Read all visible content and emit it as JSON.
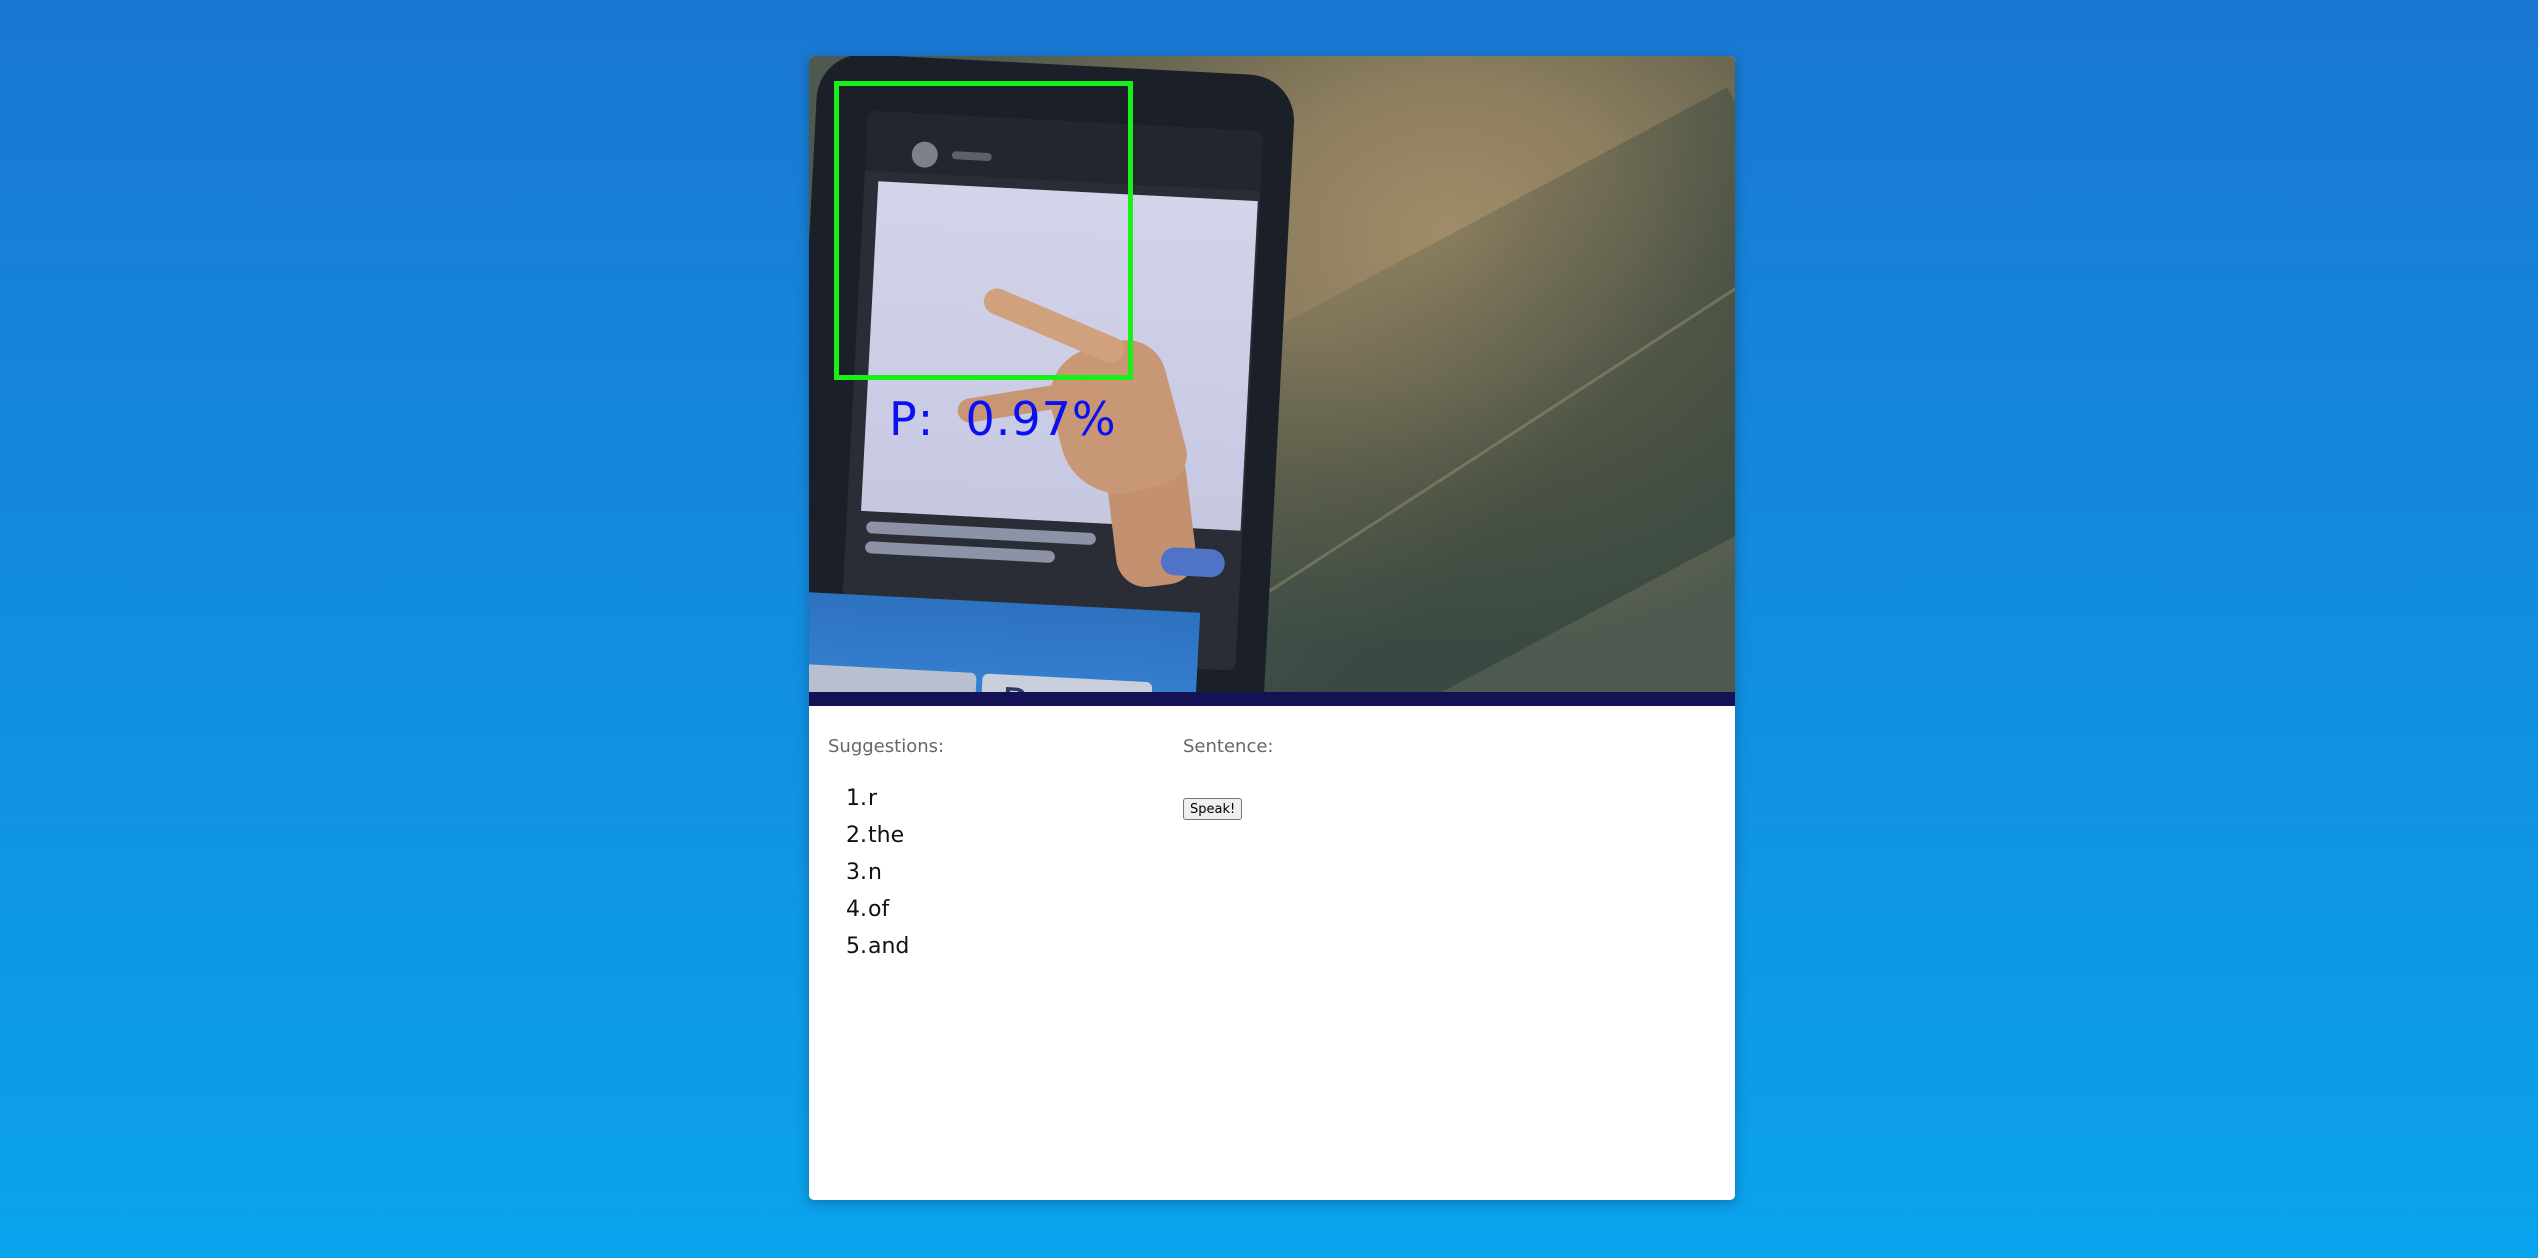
{
  "video": {
    "prediction_text": "P:  0.97%",
    "box_color": "#19f019",
    "prediction_color": "#0b10f2",
    "phone_screen_key_letter": "P"
  },
  "panel": {
    "suggestions_label": "Suggestions:",
    "sentence_label": "Sentence:",
    "sentence_text": "",
    "speak_button_label": "Speak!"
  },
  "suggestions": [
    {
      "num": "1.",
      "word": "r"
    },
    {
      "num": "2.",
      "word": "the"
    },
    {
      "num": "3.",
      "word": "n"
    },
    {
      "num": "4.",
      "word": "of"
    },
    {
      "num": "5.",
      "word": "and"
    }
  ],
  "colors": {
    "background_top": "#1a77d2",
    "background_bottom": "#0aa3ec",
    "divider": "#141255"
  }
}
